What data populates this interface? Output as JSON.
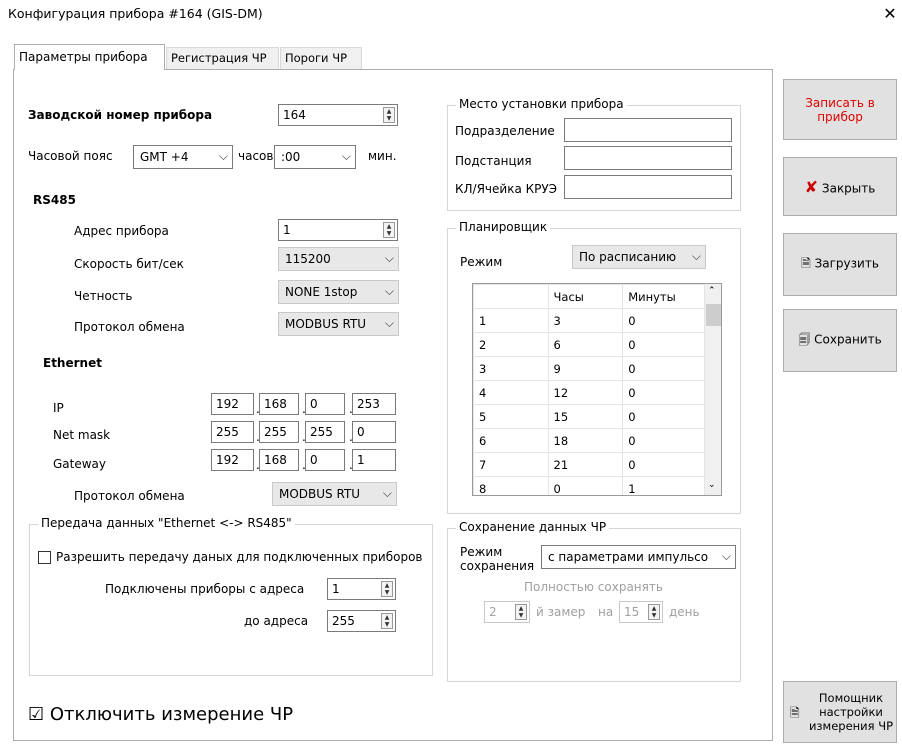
{
  "window": {
    "title": "Конфигурация прибора #164 (GIS-DM)",
    "close": "✕"
  },
  "tabs": [
    "Параметры прибора",
    "Регистрация ЧР",
    "Пороги ЧР"
  ],
  "device": {
    "serial_label": "Заводской номер прибора",
    "serial_value": "164",
    "tz_label": "Часовой пояс",
    "tz_value": "GMT  +4",
    "hours_label": "часов",
    "minutes_value": ":00",
    "min_label": "мин."
  },
  "rs485": {
    "title": "RS485",
    "addr_label": "Адрес прибора",
    "addr_value": "1",
    "speed_label": "Скорость бит/сек",
    "speed_value": "115200",
    "parity_label": "Четность",
    "parity_value": "NONE 1stop",
    "proto_label": "Протокол обмена",
    "proto_value": "MODBUS RTU"
  },
  "ethernet": {
    "title": "Ethernet",
    "ip_label": "IP",
    "ip": [
      "192",
      "168",
      "0",
      "253"
    ],
    "mask_label": "Net mask",
    "mask": [
      "255",
      "255",
      "255",
      "0"
    ],
    "gw_label": "Gateway",
    "gw": [
      "192",
      "168",
      "0",
      "1"
    ],
    "proto_label": "Протокол обмена",
    "proto_value": "MODBUS RTU"
  },
  "transfer": {
    "title": "Передача данных \"Ethernet <-> RS485\"",
    "allow_label": "Разрешить передачу даных для подключенных приборов",
    "from_label": "Подключены приборы с адреса",
    "from_value": "1",
    "to_label": "до адреса",
    "to_value": "255"
  },
  "disable_pd": "☑ Отключить измерение ЧР",
  "location": {
    "title": "Место установки прибора",
    "division": "Подразделение",
    "substation": "Подстанция",
    "cell": "КЛ/Ячейка КРУЭ"
  },
  "scheduler": {
    "title": "Планировщик",
    "mode_label": "Режим",
    "mode_value": "По расписанию",
    "headers": [
      "",
      "Часы",
      "Минуты"
    ],
    "rows": [
      [
        "1",
        "3",
        "0"
      ],
      [
        "2",
        "6",
        "0"
      ],
      [
        "3",
        "9",
        "0"
      ],
      [
        "4",
        "12",
        "0"
      ],
      [
        "5",
        "15",
        "0"
      ],
      [
        "6",
        "18",
        "0"
      ],
      [
        "7",
        "21",
        "0"
      ],
      [
        "8",
        "0",
        "1"
      ]
    ]
  },
  "save_data": {
    "title": "Сохранение данных ЧР",
    "mode_label": "Режим\nсохранения",
    "mode_value": "с параметрами импульсо",
    "full_label": "Полностью сохранять",
    "n_value": "2",
    "n_label": "й замер",
    "on_label": "на",
    "day_value": "15",
    "day_label": "день"
  },
  "buttons": {
    "write": "Записать в прибор",
    "close": "Закрыть",
    "load": "Загрузить",
    "save": "Сохранить",
    "helper": "Помощник настройки измерения ЧР"
  },
  "colors": {
    "write": "#e00000",
    "close_icon": "#cc0000"
  }
}
